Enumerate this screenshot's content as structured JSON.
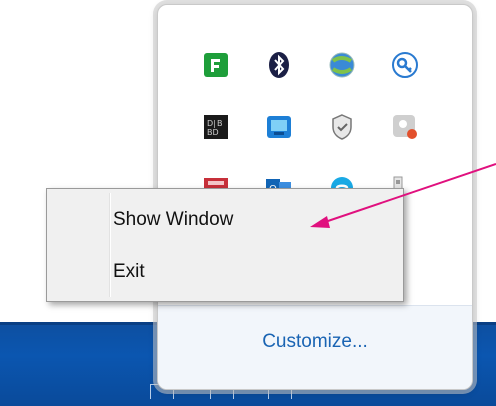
{
  "tray_icons": {
    "row1": [
      "feedly-icon",
      "bluetooth-icon",
      "network-globe-icon",
      "key-icon"
    ],
    "row2": [
      "dolby-icon",
      "intel-graphics-icon",
      "shield-icon",
      "camera-record-icon"
    ],
    "row3": [
      "red-app-icon",
      "outlook-icon",
      "skype-icon",
      "usb-icon"
    ]
  },
  "context_menu": {
    "items": [
      "Show Window",
      "Exit"
    ]
  },
  "flyout": {
    "customize_label": "Customize..."
  },
  "colors": {
    "taskbar": "#0b56b0",
    "link": "#1a64b3",
    "arrow": "#e0107e"
  }
}
